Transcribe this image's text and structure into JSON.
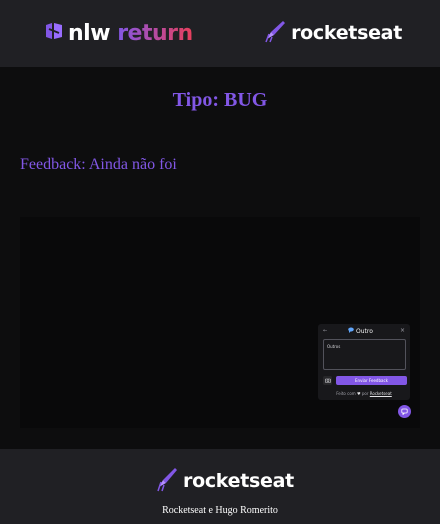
{
  "header": {
    "nlw_logo": {
      "part1": "nlw",
      "part2": "return",
      "icon": "nlw-icon"
    },
    "rocketseat_logo": {
      "text": "rocketseat",
      "icon": "rocket-icon"
    }
  },
  "main": {
    "title": "Tipo: BUG",
    "feedback": "Feedback: Ainda não foi"
  },
  "screenshot": {
    "widget": {
      "back_label": "←",
      "title": "Outro",
      "title_icon": "chat-bubble-icon",
      "close_label": "×",
      "textarea_value": "Outros",
      "camera_icon": "camera-icon",
      "send_label": "Enviar Feedback",
      "footer_prefix": "Feito com",
      "heart": "♥",
      "footer_mid": "por",
      "footer_link": "Rocketseat"
    },
    "fab_icon": "chat-icon"
  },
  "footer": {
    "logo_text": "rocketseat",
    "credit": "Rocketseat e Hugo Romerito"
  },
  "colors": {
    "brand": "#8257e6",
    "accent_pink": "#e83f5b",
    "surface": "#202024",
    "background": "#0d0d0e"
  }
}
